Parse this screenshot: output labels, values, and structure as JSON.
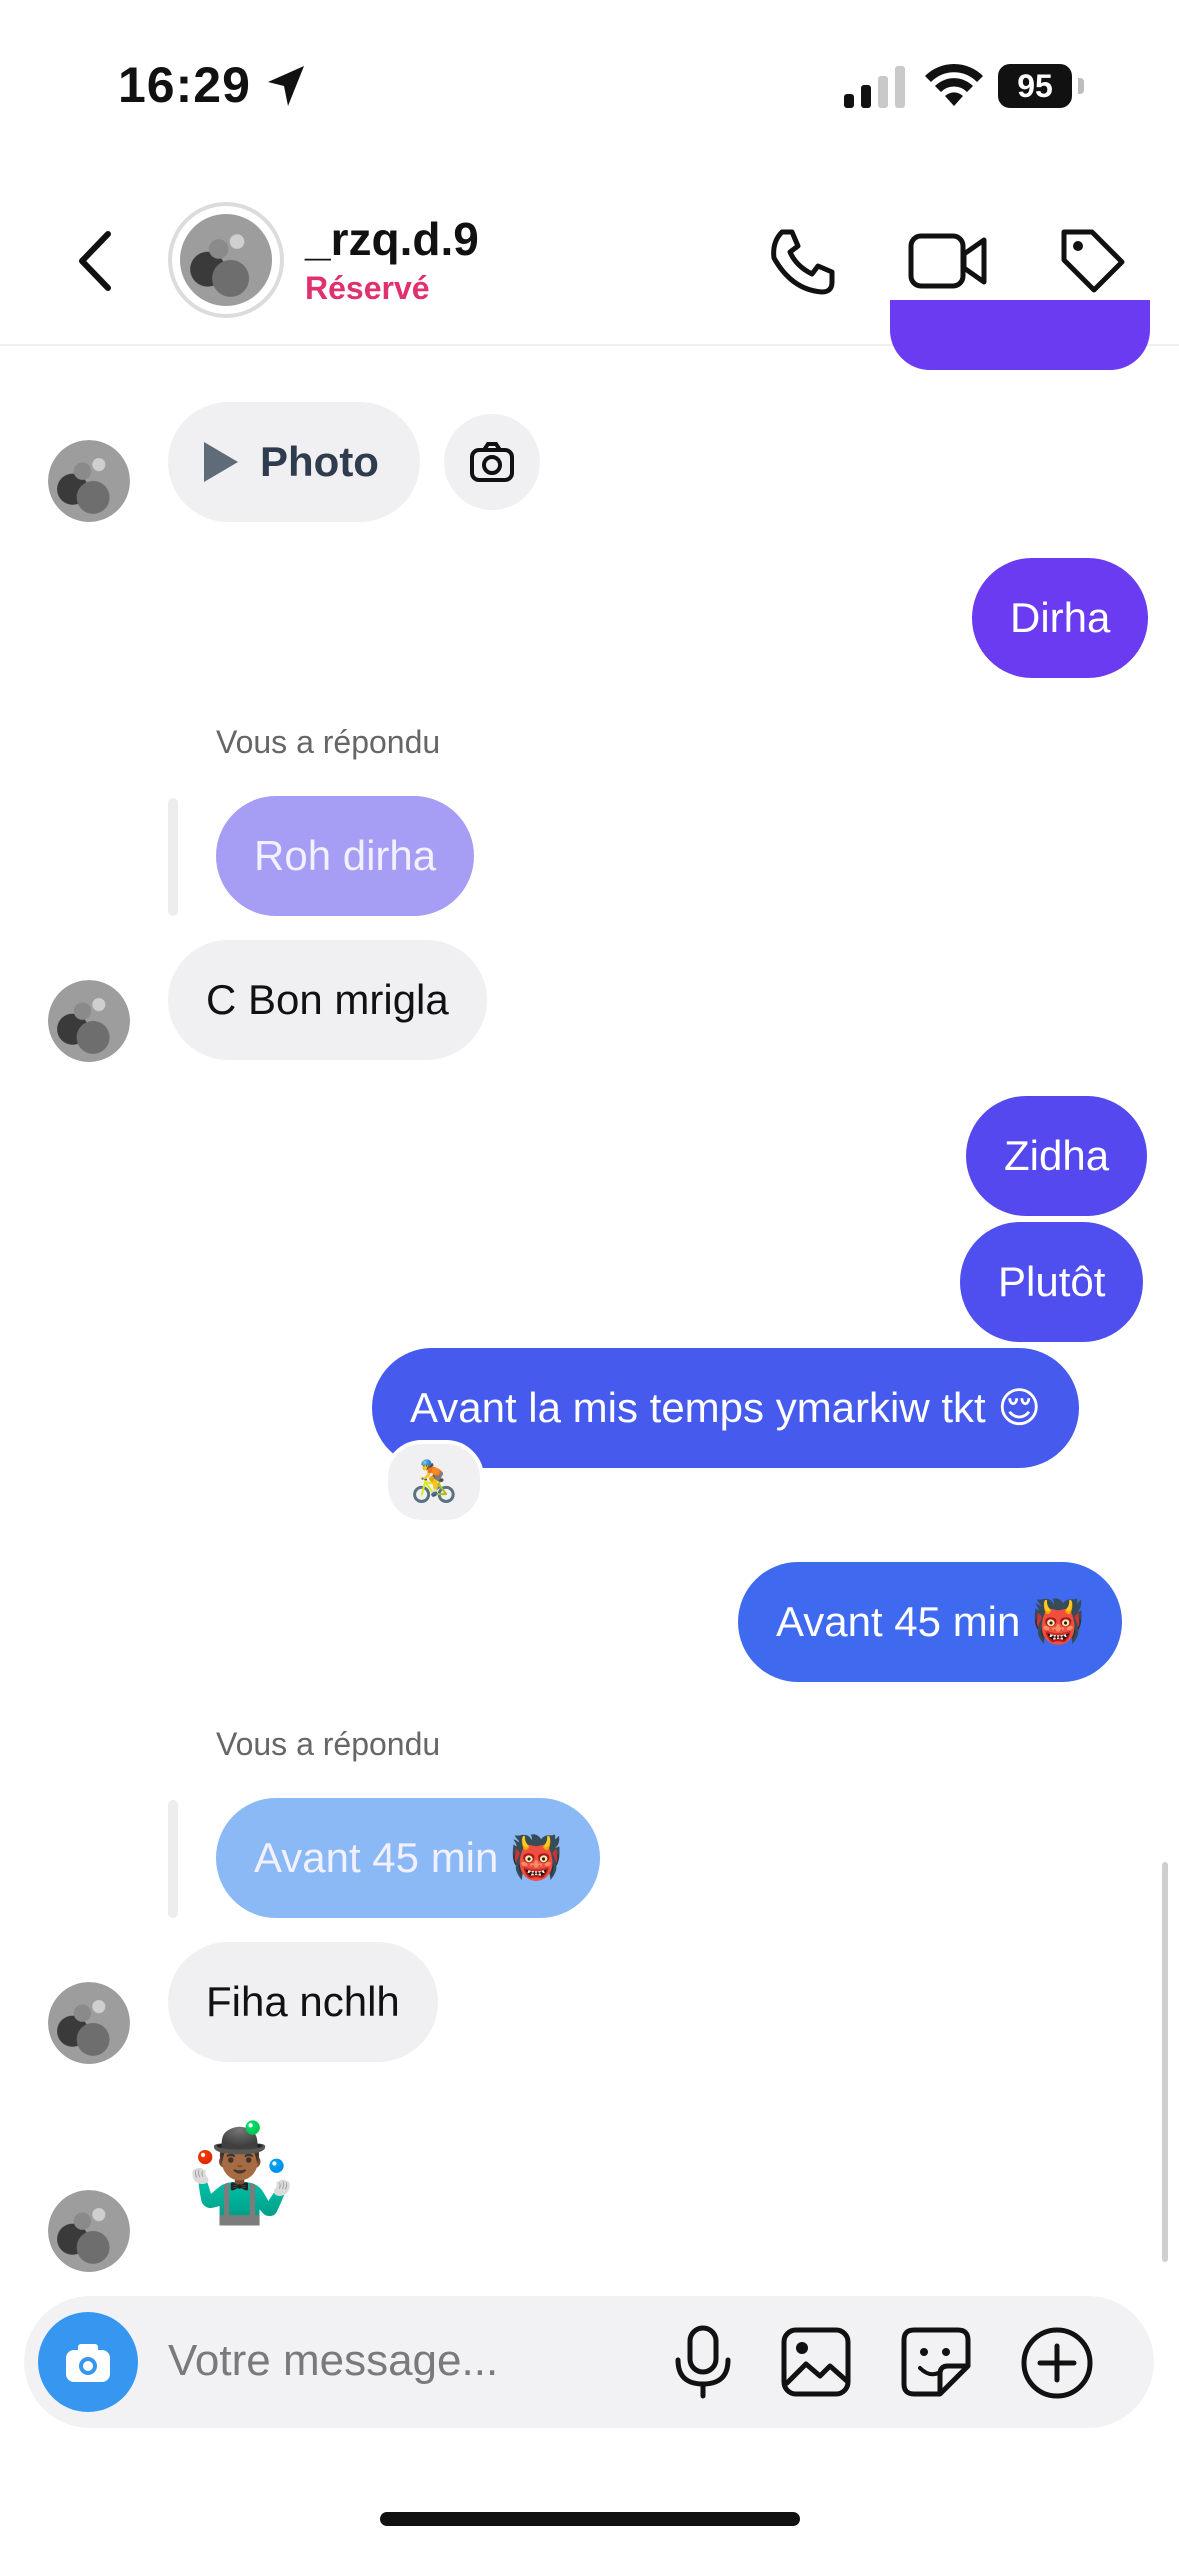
{
  "status_bar": {
    "time": "16:29",
    "battery": "95"
  },
  "header": {
    "username": "_rzq.d.9",
    "status": "Réservé"
  },
  "messages": {
    "photo_label": "Photo",
    "dirha": "Dirha",
    "reply_label": "Vous a répondu",
    "quoted_1": "Roh dirha",
    "c_bon": "C Bon mrigla",
    "zidha": "Zidha",
    "plutot": "Plutôt",
    "avant_temps": "Avant la mis temps ymarkiw tkt 😌",
    "reaction": "🚴",
    "avant_45": "Avant 45 min 👹",
    "quoted_2": "Avant 45 min 👹",
    "fiha": "Fiha nchlh",
    "juggler": "🤹🏾‍♂️"
  },
  "composer": {
    "placeholder": "Votre message..."
  },
  "colors": {
    "accent_purple": "#6a3bf0",
    "accent_blue": "#3b66ee",
    "status_pink": "#e0306e",
    "camera_blue": "#3797f0"
  }
}
